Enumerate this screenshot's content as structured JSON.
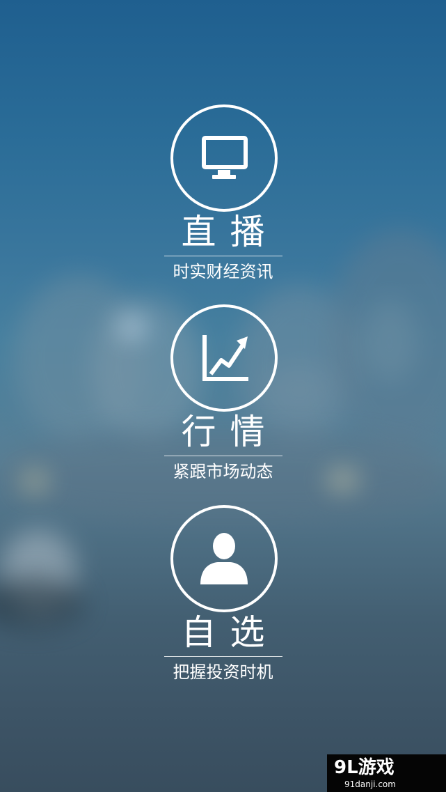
{
  "features": [
    {
      "id": "live",
      "title": "直播",
      "subtitle": "时实财经资讯",
      "icon": "monitor-icon"
    },
    {
      "id": "market",
      "title": "行情",
      "subtitle": "紧跟市场动态",
      "icon": "trend-chart-icon"
    },
    {
      "id": "watchlist",
      "title": "自选",
      "subtitle": "把握投资时机",
      "icon": "user-icon"
    }
  ],
  "watermark": {
    "brand": "9L游戏",
    "site": "91danji.com"
  },
  "colors": {
    "text": "#ffffff",
    "background_top": "#1f5f8f",
    "background_bottom": "#384d5e",
    "watermark_bg": "#050505"
  }
}
